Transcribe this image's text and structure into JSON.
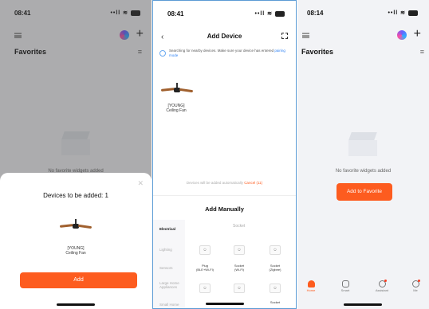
{
  "screen1": {
    "status_time": "08:41",
    "status_icons": "••ll ≋",
    "favorites_title": "Favorites",
    "empty_text": "No favorite widgets added",
    "sheet": {
      "title": "Devices to be added: 1",
      "device_name_line1": "[YOUNG]",
      "device_name_line2": "Ceiling Fan",
      "add_button": "Add",
      "close_icon": "✕"
    }
  },
  "screen2": {
    "status_time": "08:41",
    "status_icons": "••ll ≋",
    "title": "Add Device",
    "search_text": "Searching for nearby devices. Make sure your device has entered",
    "pairing_mode_link": "pairing mode",
    "found_device_line1": "[YOUNG]",
    "found_device_line2": "Ceiling Fan",
    "note_text": "Devices will be added automatically",
    "note_cancel": "Cancel (11)",
    "add_manually": "Add Manually",
    "categories": [
      {
        "label": "Electrical",
        "active": true
      },
      {
        "label": "Lighting",
        "active": false
      },
      {
        "label": "Sensors",
        "active": false
      },
      {
        "label": "Large Home Appliances",
        "active": false
      },
      {
        "label": "Small Home",
        "active": false
      }
    ],
    "right_tab": "Socket",
    "grid_row1": [
      {
        "label": ""
      },
      {
        "label": ""
      },
      {
        "label": ""
      }
    ],
    "grid_row2": [
      {
        "label1": "Plug",
        "label2": "(BLE+Wi-Fi)"
      },
      {
        "label1": "Socket",
        "label2": "(Wi-Fi)"
      },
      {
        "label1": "Socket",
        "label2": "(Zigbee)"
      }
    ],
    "grid_row4": [
      {
        "label1": ""
      },
      {
        "label1": ""
      },
      {
        "label1": "Socket"
      }
    ]
  },
  "screen3": {
    "status_time": "08:14",
    "status_icons": "••ll ≋",
    "favorites_title": "Favorites",
    "empty_text": "No favorite widgets added",
    "add_favorite_button": "Add to Favorite",
    "tabs": [
      {
        "label": "Home",
        "active": true
      },
      {
        "label": "Smart",
        "active": false
      },
      {
        "label": "Assistant",
        "active": false
      },
      {
        "label": "Me",
        "active": false
      }
    ]
  },
  "colors": {
    "accent": "#fd5c1f",
    "link": "#2f82f3"
  }
}
